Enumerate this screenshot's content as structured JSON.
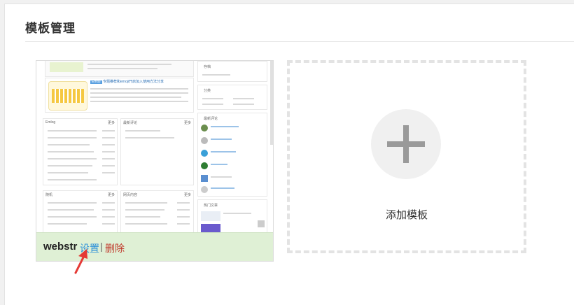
{
  "page": {
    "title": "模板管理"
  },
  "template_card": {
    "name": "webstr",
    "settings_label": "设置",
    "separator": "|",
    "delete_label": "删除",
    "preview": {
      "article_badge": "Emoji",
      "article_title": "专题推荐和emoji开启加入使用方法分享",
      "sections": [
        "Emlog",
        "最新评论",
        "随机",
        "网页内容"
      ],
      "sidebar": [
        "存档",
        "分类",
        "最新评论",
        "热门文章"
      ],
      "more_label": "更多"
    }
  },
  "add_template": {
    "label": "添加模板",
    "icon": "plus-icon"
  },
  "colors": {
    "footer_bg": "#dff0d5",
    "settings_link": "#2a8fd8",
    "delete_link": "#c0392b",
    "arrow": "#e53935"
  }
}
